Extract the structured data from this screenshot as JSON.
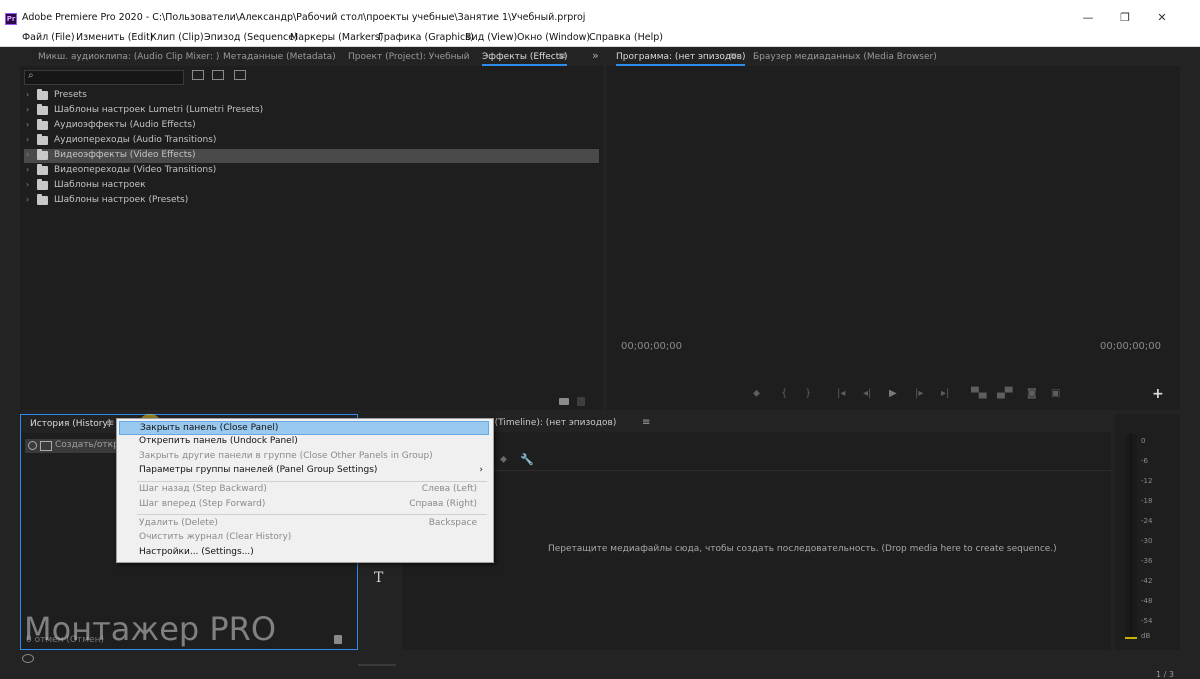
{
  "window": {
    "title": "Adobe Premiere Pro 2020 - C:\\Пользователи\\Александр\\Рабочий стол\\проекты учебные\\Занятие 1\\Учебный.prproj",
    "logo_letters": "Pr",
    "minimize": "—",
    "restore": "❐",
    "close": "✕"
  },
  "menubar": [
    "Файл (File)",
    "Изменить (Edit)",
    "Клип (Clip)",
    "Эпизод (Sequence)",
    "Маркеры (Markers)",
    "Графика (Graphics)",
    "Вид (View)",
    "Окно (Window)",
    "Справка (Help)"
  ],
  "top_left_panel": {
    "tabs": [
      "Микш. аудиоклипа: (Audio Clip Mixer: )",
      "Метаданные (Metadata)",
      "Проект (Project): Учебный",
      "Эффекты (Effects)"
    ],
    "overflow": "»",
    "search_icon": "⌕",
    "tree": [
      {
        "label": "Presets"
      },
      {
        "label": "Шаблоны настроек Lumetri (Lumetri Presets)"
      },
      {
        "label": "Аудиоэффекты (Audio Effects)"
      },
      {
        "label": "Аудиопереходы (Audio Transitions)"
      },
      {
        "label": "Видеоэффекты (Video Effects)",
        "selected": true
      },
      {
        "label": "Видеопереходы (Video Transitions)"
      },
      {
        "label": "Шаблоны настроек"
      },
      {
        "label": "Шаблоны настроек (Presets)"
      }
    ]
  },
  "program_monitor": {
    "tabs": [
      "Программа: (нет эпизодов)",
      "Браузер медиаданных (Media Browser)"
    ],
    "timecode_left": "00;00;00;00",
    "timecode_right": "00;00;00;00",
    "add_button": "+"
  },
  "history_panel": {
    "tab": "История (History)",
    "row_label": "Создать/открыть",
    "footer": "0 отмен (Отмен)"
  },
  "timeline_panel": {
    "tab": "Временная шкала (Timeline): (нет эпизодов)",
    "empty_message": "Перетащите медиафайлы сюда, чтобы создать последовательность. (Drop media here to create sequence.)",
    "page_indicator": "1 / 3"
  },
  "tools": {
    "type_tool": "T"
  },
  "audio_meter": {
    "scale": [
      "0",
      "-6",
      "-12",
      "-18",
      "-24",
      "-30",
      "-36",
      "-42",
      "-48",
      "-54",
      "dB"
    ]
  },
  "context_menu": {
    "items": [
      {
        "label": "Закрыть панель (Close Panel)",
        "highlighted": true
      },
      {
        "label": "Открепить панель (Undock Panel)"
      },
      {
        "label": "Закрыть другие панели в группе (Close Other Panels in Group)",
        "disabled": true
      },
      {
        "label": "Параметры группы панелей (Panel Group Settings)",
        "submenu": "›"
      },
      {
        "label": "Шаг назад (Step Backward)",
        "shortcut": "Слева (Left)",
        "disabled": true
      },
      {
        "label": "Шаг вперед (Step Forward)",
        "shortcut": "Справа (Right)",
        "disabled": true
      },
      {
        "label": "Удалить (Delete)",
        "shortcut": "Backspace",
        "disabled": true
      },
      {
        "label": "Очистить журнал (Clear History)",
        "disabled": true
      },
      {
        "label": "Настройки... (Settings...)"
      }
    ]
  },
  "watermark": "Монтажер PRO",
  "colors": {
    "accent": "#2d8ceb",
    "menu_highlight": "#99c9ef",
    "meter_level": "#c8b400"
  }
}
